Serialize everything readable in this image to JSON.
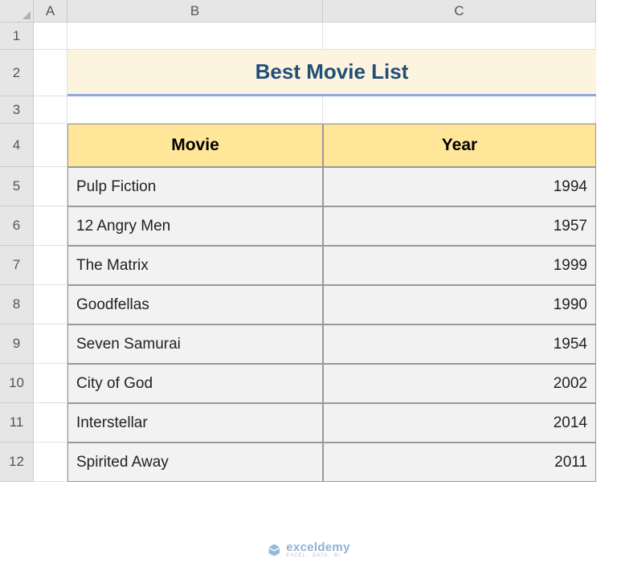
{
  "columns": [
    "A",
    "B",
    "C"
  ],
  "rows": [
    "1",
    "2",
    "3",
    "4",
    "5",
    "6",
    "7",
    "8",
    "9",
    "10",
    "11",
    "12"
  ],
  "title": "Best Movie List",
  "table": {
    "headers": {
      "movie": "Movie",
      "year": "Year"
    },
    "data": [
      {
        "movie": " Pulp  Fiction",
        "year": "1994"
      },
      {
        "movie": " 12 Angry Men",
        "year": "1957"
      },
      {
        "movie": "The Matrix",
        "year": "1999"
      },
      {
        "movie": " Goodfellas",
        "year": "1990"
      },
      {
        "movie": "Seven Samurai",
        "year": "1954"
      },
      {
        "movie": " City of God",
        "year": "2002"
      },
      {
        "movie": "Interstellar",
        "year": "2014"
      },
      {
        "movie": " Spirited Away",
        "year": "2011"
      }
    ]
  },
  "watermark": {
    "main": "exceldemy",
    "sub": "EXCEL · DATA · BI"
  },
  "chart_data": {
    "type": "table",
    "title": "Best Movie List",
    "columns": [
      "Movie",
      "Year"
    ],
    "rows": [
      [
        "Pulp Fiction",
        1994
      ],
      [
        "12 Angry Men",
        1957
      ],
      [
        "The Matrix",
        1999
      ],
      [
        "Goodfellas",
        1990
      ],
      [
        "Seven Samurai",
        1954
      ],
      [
        "City of God",
        2002
      ],
      [
        "Interstellar",
        2014
      ],
      [
        "Spirited Away",
        2011
      ]
    ]
  }
}
